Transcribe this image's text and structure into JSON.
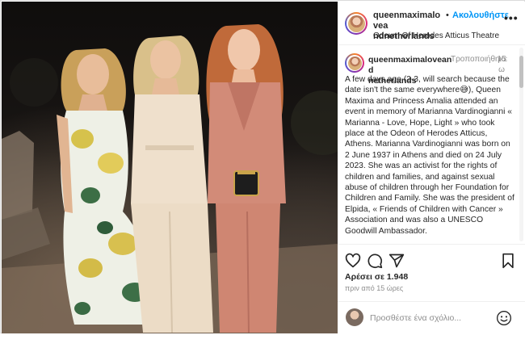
{
  "post": {
    "username": "queenmaximaloveandnetherlands",
    "username_line1": "queenmaximalovea",
    "username_line2": "ndnetherlands",
    "separator": "•",
    "follow_label": "Ακολουθήστε",
    "more_label": "•••",
    "location": "Odeum Of Herodes Atticus Theatre"
  },
  "caption": {
    "username_line1": "queenmaximaloveand",
    "username_line2": "netherlands",
    "edited_label": "Τροποποιήθηκε",
    "time_label": "15 ω",
    "text": "A few days ago (2-3, will search because the date isn't the same everywhere😅), Queen Maxima and Princess Amalia attended an event in memory of Marianna Vardinogianni « Marianna - Love, Hope, Light » who took place at the Odeon of Herodes Atticus, Athens. Marianna Vardinogianni was born on 2 June 1937 in Athens and died on 24 July 2023. She was an activist for the rights of children and families, and against sexual abuse of children through her Foundation for Children and Family. She was the president of Elpida, « Friends of Children with Cancer » Association and was also a UNESCO Goodwill Ambassador."
  },
  "actions": {
    "icons": [
      "heart-icon",
      "comment-icon",
      "share-icon",
      "bookmark-icon"
    ]
  },
  "stats": {
    "likes_label": "Αρέσει σε 1.948",
    "time_ago": "πριν από 15 ώρες"
  },
  "comment": {
    "placeholder": "Προσθέστε ένα σχόλιο..."
  },
  "colors": {
    "accent": "#0095f6",
    "text": "#262626",
    "muted": "#8e8e8e",
    "border": "#dbdbdb"
  }
}
